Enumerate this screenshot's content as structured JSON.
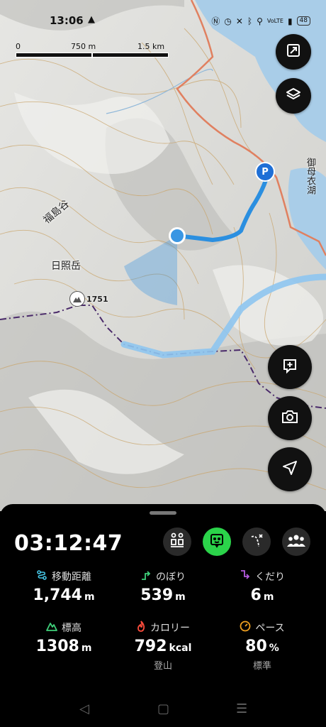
{
  "status_bar": {
    "time": "13:06",
    "icons": [
      "nfc-icon",
      "alarm-icon",
      "mute-icon",
      "bluetooth-icon",
      "location-icon",
      "volte-icon",
      "signal-icon"
    ],
    "volte": "VoLTE",
    "battery": "48"
  },
  "map": {
    "scale": {
      "zero": "0",
      "mid": "750 m",
      "end": "1.5 km"
    },
    "labels": {
      "valley": "福島谷",
      "mountain": "日照岳",
      "peak_elevation": "1751",
      "river": "御母衣湖",
      "parking": "P"
    },
    "colors": {
      "track": "#2b8fe0",
      "planned_route": "#8ec5f0",
      "boundary": "#4a2a6a",
      "road": "#e08060",
      "water": "#a9cde8"
    }
  },
  "controls": {
    "fullscreen": "fullscreen-icon",
    "layers": "layers-icon",
    "add_note": "add-note-icon",
    "camera": "camera-icon",
    "locate": "navigation-arrow-icon"
  },
  "activity": {
    "elapsed": "03:12:47",
    "modes": [
      "people-gps-icon",
      "face-icon",
      "route-icon",
      "group-icon"
    ],
    "active_color": "#2bd34a",
    "stats": {
      "distance": {
        "label": "移動距離",
        "value": "1,744",
        "unit": "m"
      },
      "ascent": {
        "label": "のぼり",
        "value": "539",
        "unit": "m"
      },
      "descent": {
        "label": "くだり",
        "value": "6",
        "unit": "m"
      },
      "elevation": {
        "label": "標高",
        "value": "1308",
        "unit": "m"
      },
      "calories": {
        "label": "カロリー",
        "value": "792",
        "unit": "kcal",
        "sub": "登山"
      },
      "pace": {
        "label": "ペース",
        "value": "80",
        "unit": "%",
        "sub": "標準"
      }
    }
  },
  "navbar": {
    "back": "◁",
    "home": "▢",
    "recents": "☰"
  }
}
